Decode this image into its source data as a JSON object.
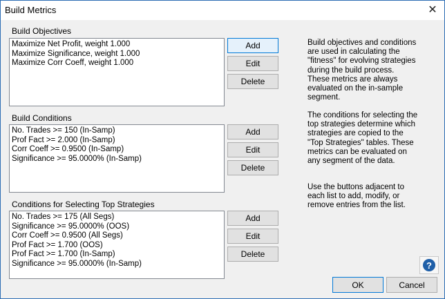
{
  "window": {
    "title": "Build Metrics"
  },
  "objectives": {
    "label": "Build Objectives",
    "items": [
      "Maximize Net Profit, weight 1.000",
      "Maximize Significance, weight 1.000",
      "Maximize Corr Coeff, weight 1.000"
    ]
  },
  "conditions": {
    "label": "Build Conditions",
    "items": [
      "No. Trades >=  150 (In-Samp)",
      "Prof Fact >=  2.000 (In-Samp)",
      "Corr Coeff >=  0.9500 (In-Samp)",
      "Significance >=  95.0000% (In-Samp)"
    ]
  },
  "top": {
    "label": "Conditions for Selecting Top Strategies",
    "items": [
      "No. Trades >=  175 (All Segs)",
      "Significance >=  95.0000% (OOS)",
      "Corr Coeff >=  0.9500 (All Segs)",
      "Prof Fact >=  1.700 (OOS)",
      "Prof Fact >=  1.700 (In-Samp)",
      "Significance >=  95.0000% (In-Samp)"
    ]
  },
  "buttons": {
    "add": "Add",
    "edit": "Edit",
    "delete": "Delete",
    "ok": "OK",
    "cancel": "Cancel",
    "help": "?"
  },
  "help": {
    "p1": "Build objectives and conditions are used in calculating the \"fitness\" for evolving strategies during the build process. These metrics are always evaluated on the in-sample segment.",
    "p2": "The conditions for selecting the top strategies determine which strategies are copied to the \"Top Strategies\" tables. These metrics can be evaluated on any segment of the data.",
    "p3": "Use the buttons adjacent to each list to add, modify, or remove entries from the list."
  }
}
